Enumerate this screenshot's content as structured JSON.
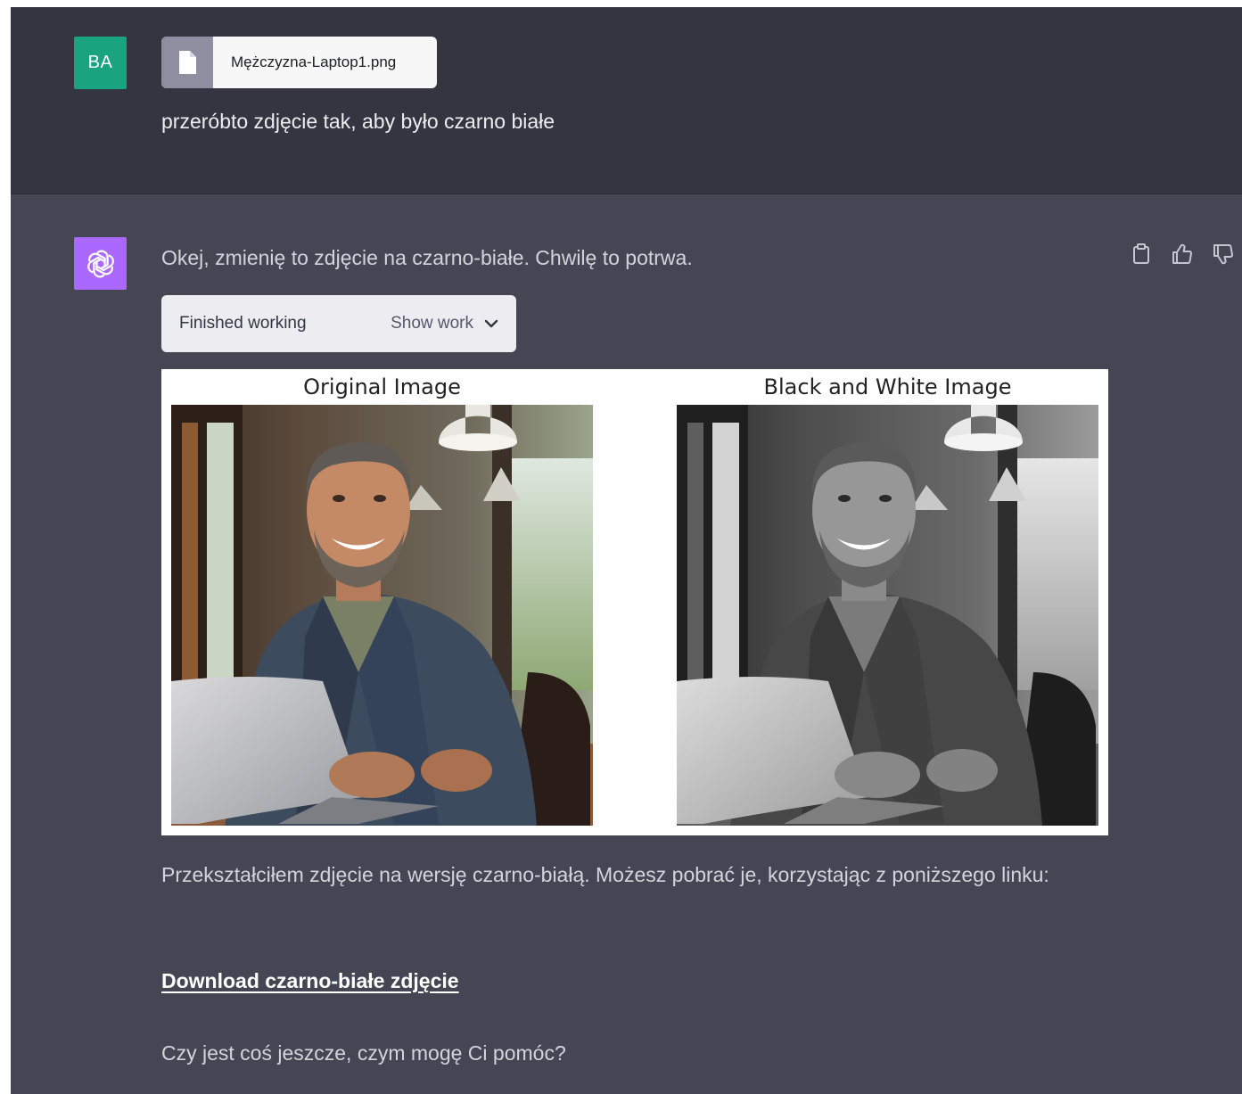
{
  "user_message": {
    "avatar_initials": "BA",
    "attachment": {
      "icon": "file-icon",
      "filename": "Mężczyzna-Laptop1.png"
    },
    "text": "przeróbto zdjęcie tak, aby było czarno białe"
  },
  "assistant_message": {
    "avatar_icon": "openai-logo-icon",
    "intro": "Okej, zmienię to zdjęcie na czarno-białe. Chwilę to potrwa.",
    "actions": [
      {
        "name": "copy-icon"
      },
      {
        "name": "thumbs-up-icon"
      },
      {
        "name": "thumbs-down-icon"
      }
    ],
    "work_box": {
      "status": "Finished working",
      "toggle_label": "Show work",
      "toggle_icon": "chevron-down-icon"
    },
    "figure": {
      "left_title": "Original Image",
      "right_title": "Black and White Image"
    },
    "result_text": "Przekształciłem zdjęcie na wersję czarno-białą. Możesz pobrać je, korzystając z poniższego linku:",
    "download_link": "Download czarno-białe zdjęcie",
    "closing": "Czy jest coś jeszcze, czym mogę Ci pomóc?"
  },
  "colors": {
    "user_bg": "#343541",
    "assistant_bg": "#444654",
    "user_avatar": "#19a37f",
    "assistant_avatar": "#ab68ff"
  }
}
